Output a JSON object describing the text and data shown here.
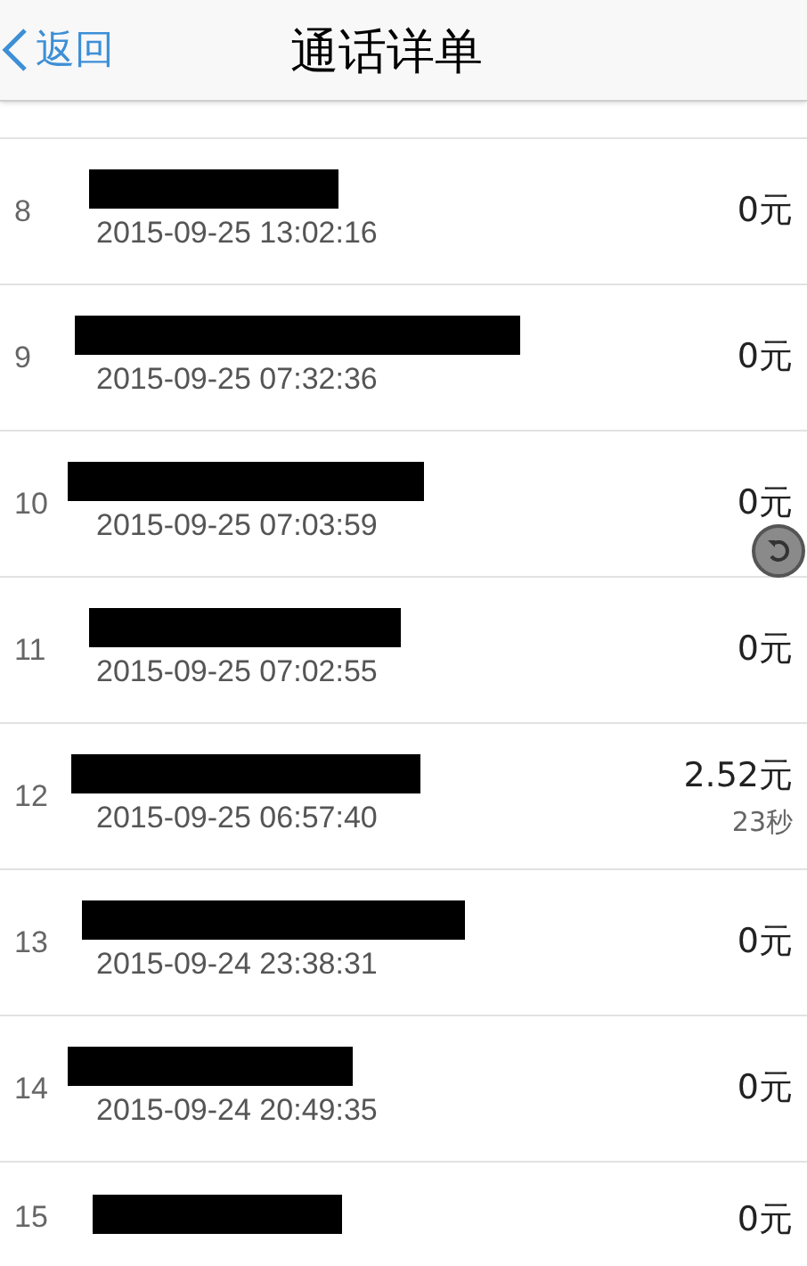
{
  "header": {
    "back": "返回",
    "title": "通话详单"
  },
  "rows": [
    {
      "index": "8",
      "time": "2015-09-25 13:02:16",
      "amount": "0元"
    },
    {
      "index": "9",
      "time": "2015-09-25 07:32:36",
      "amount": "0元"
    },
    {
      "index": "10",
      "time": "2015-09-25 07:03:59",
      "amount": "0元"
    },
    {
      "index": "11",
      "time": "2015-09-25 07:02:55",
      "amount": "0元"
    },
    {
      "index": "12",
      "time": "2015-09-25 06:57:40",
      "amount": "2.52元",
      "duration": "23秒"
    },
    {
      "index": "13",
      "time": "2015-09-24 23:38:31",
      "amount": "0元"
    },
    {
      "index": "14",
      "time": "2015-09-24 20:49:35",
      "amount": "0元"
    },
    {
      "index": "15",
      "amount": "0元"
    }
  ]
}
